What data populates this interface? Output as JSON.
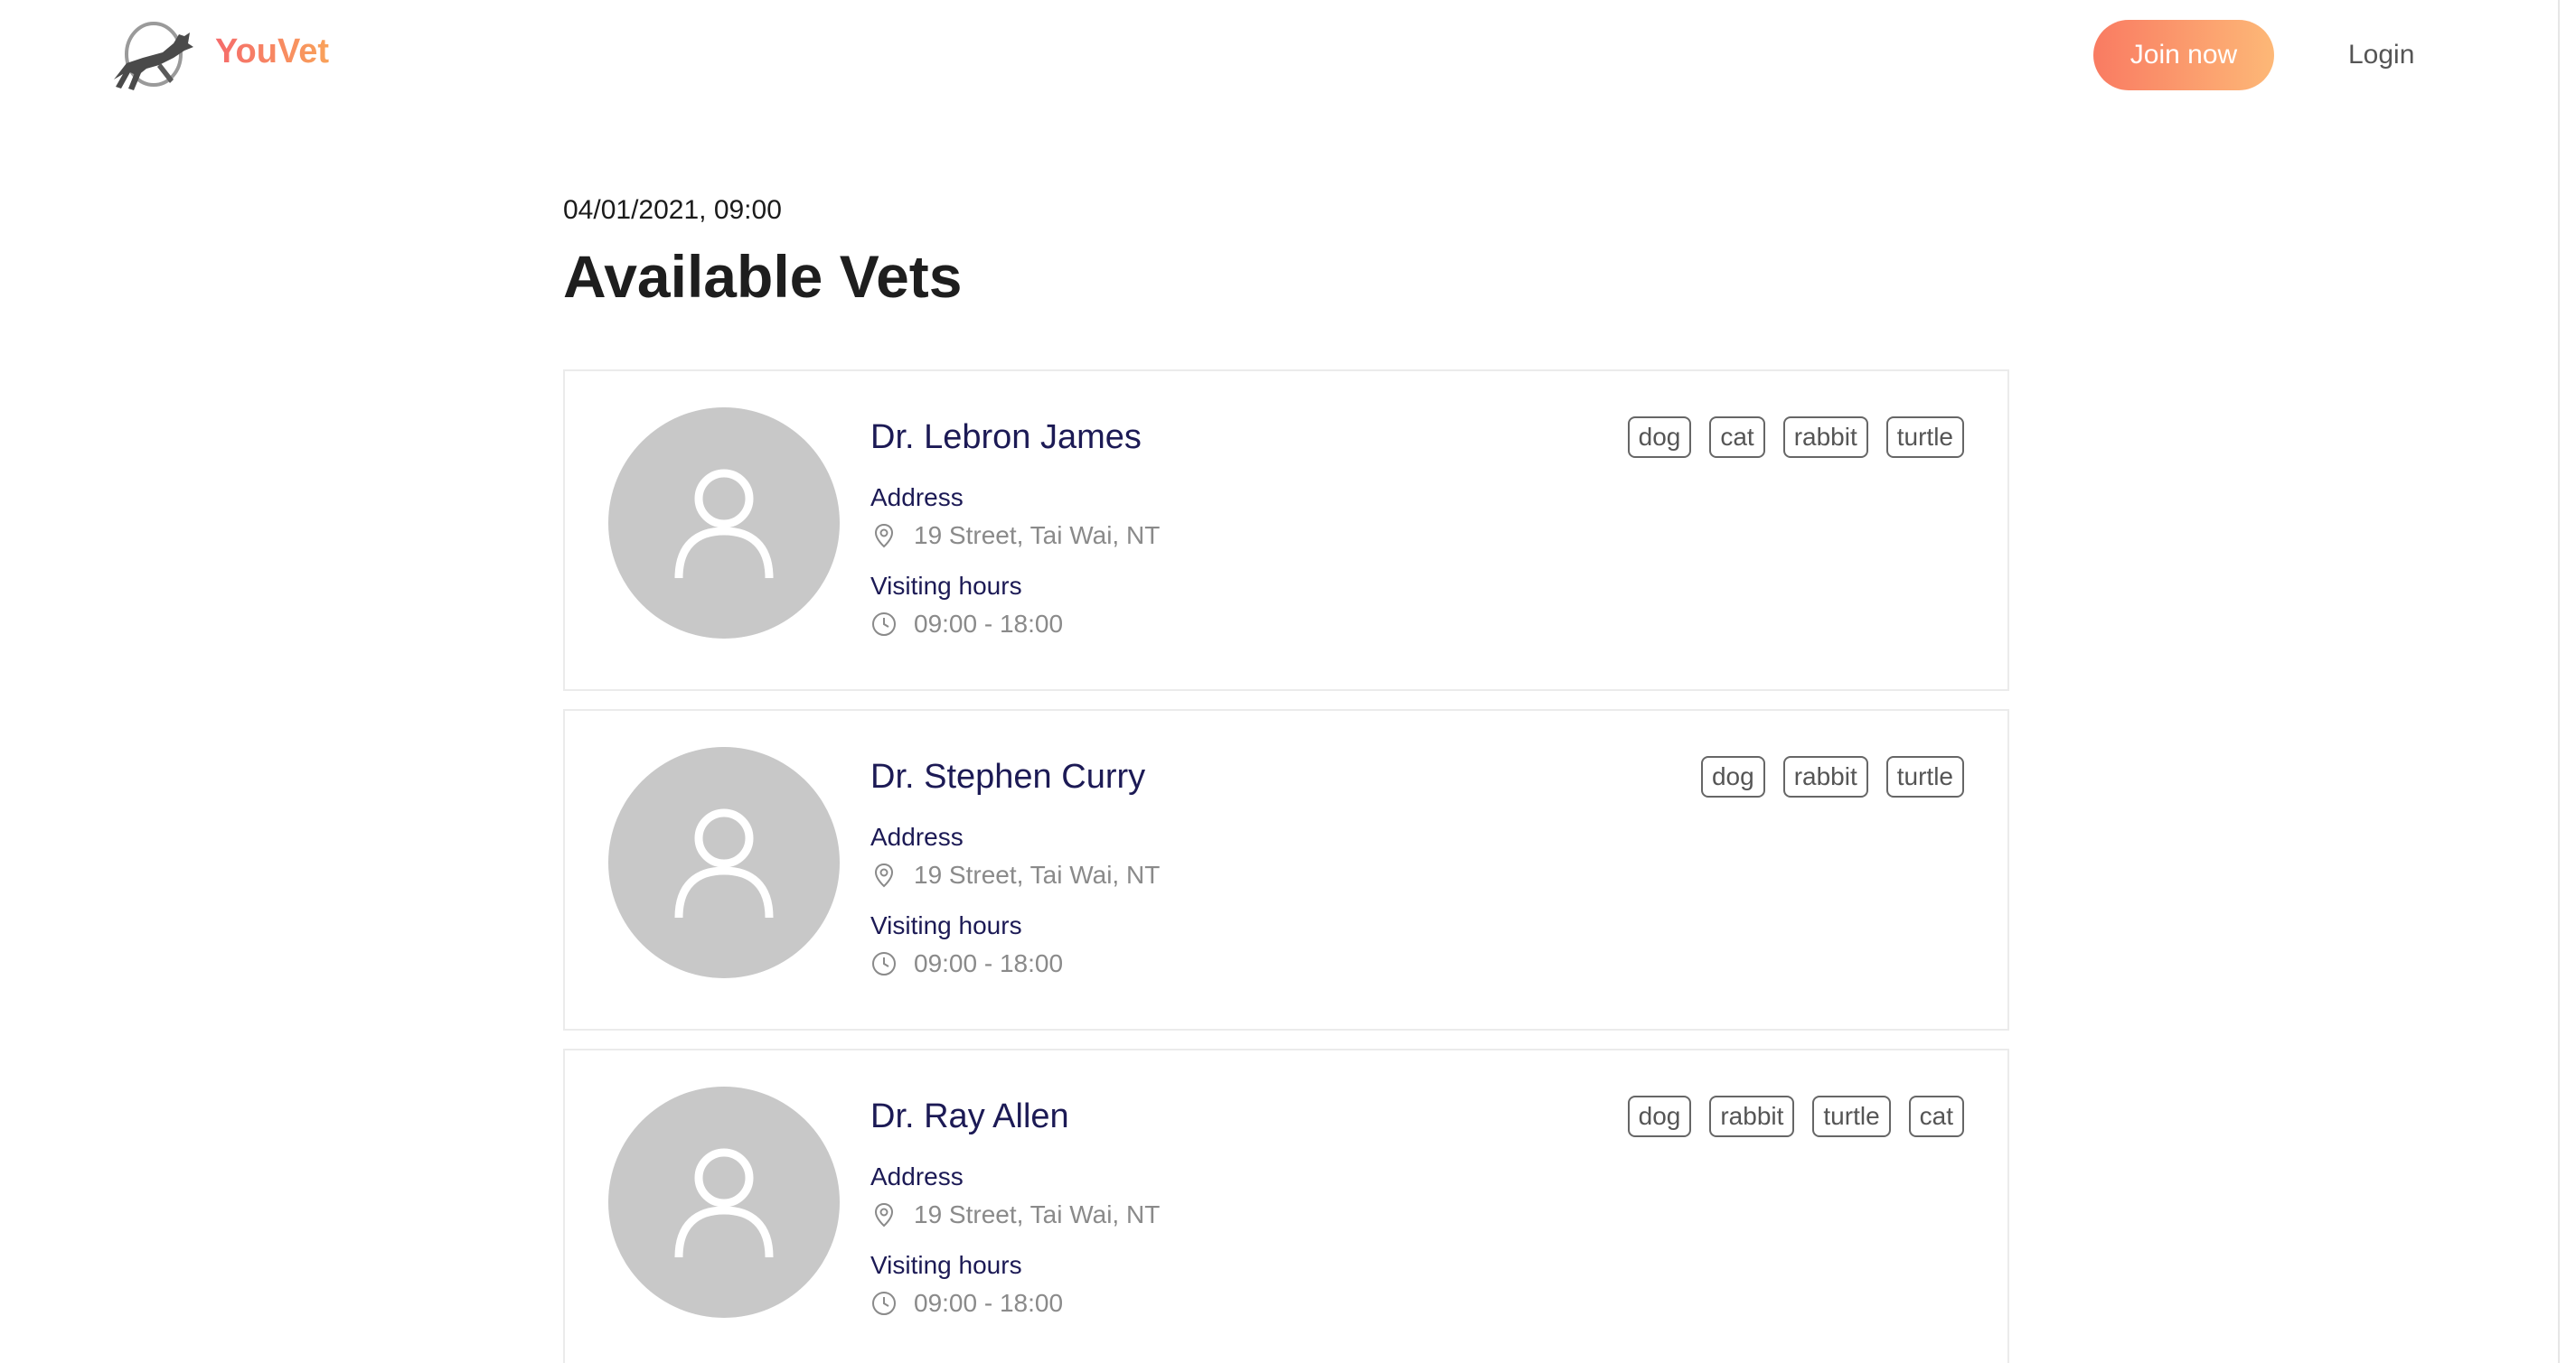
{
  "header": {
    "brand": "YouVet",
    "join_label": "Join now",
    "login_label": "Login"
  },
  "main": {
    "datetime": "04/01/2021, 09:00",
    "title": "Available Vets"
  },
  "vets": [
    {
      "name": "Dr. Lebron James",
      "address_label": "Address",
      "address": "19 Street, Tai Wai, NT",
      "hours_label": "Visiting hours",
      "hours": "09:00 - 18:00",
      "tags": [
        "dog",
        "cat",
        "rabbit",
        "turtle"
      ]
    },
    {
      "name": "Dr. Stephen Curry",
      "address_label": "Address",
      "address": "19 Street, Tai Wai, NT",
      "hours_label": "Visiting hours",
      "hours": "09:00 - 18:00",
      "tags": [
        "dog",
        "rabbit",
        "turtle"
      ]
    },
    {
      "name": "Dr. Ray Allen",
      "address_label": "Address",
      "address": "19 Street, Tai Wai, NT",
      "hours_label": "Visiting hours",
      "hours": "09:00 - 18:00",
      "tags": [
        "dog",
        "rabbit",
        "turtle",
        "cat"
      ]
    }
  ],
  "icons": {
    "logo": "dog-jumping-logo-icon",
    "avatar": "user-placeholder-icon",
    "address": "map-pin-icon",
    "hours": "clock-icon"
  },
  "colors": {
    "brand_start": "#f56b6b",
    "brand_end": "#f9a25a",
    "button_start": "#f97b62",
    "button_end": "#fdb877",
    "name_color": "#1c1a55",
    "avatar_bg": "#c8c8c8"
  }
}
